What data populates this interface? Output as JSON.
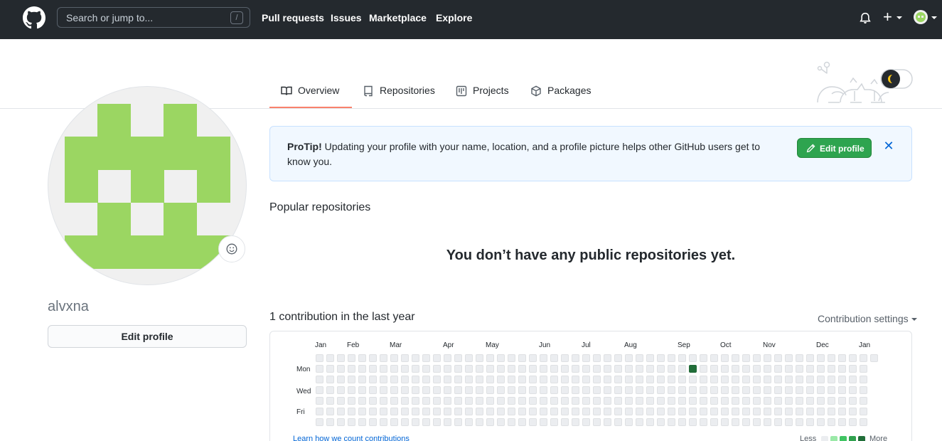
{
  "header": {
    "search_placeholder": "Search or jump to...",
    "search_shortcut": "/",
    "nav": [
      "Pull requests",
      "Issues",
      "Marketplace",
      "Explore"
    ],
    "plus": "+"
  },
  "tabs": [
    {
      "label": "Overview",
      "icon": "book-icon",
      "selected": true
    },
    {
      "label": "Repositories",
      "icon": "repo-icon"
    },
    {
      "label": "Projects",
      "icon": "project-icon"
    },
    {
      "label": "Packages",
      "icon": "package-icon"
    }
  ],
  "profile": {
    "username": "alvxna",
    "edit_label": "Edit profile",
    "avatar_color": "#9bd662"
  },
  "protip": {
    "title": "ProTip!",
    "text": "Updating your profile with your name, location, and a profile picture helps other GitHub users get to know you.",
    "button": "Edit profile",
    "close": "✕"
  },
  "repos": {
    "title": "Popular repositories",
    "empty": "You don’t have any public repositories yet."
  },
  "contributions": {
    "title": "1 contribution in the last year",
    "settings": "Contribution settings",
    "months": [
      "Jan",
      "Feb",
      "Mar",
      "Apr",
      "May",
      "Jun",
      "Jul",
      "Aug",
      "Sep",
      "Oct",
      "Nov",
      "Dec",
      "Jan"
    ],
    "days": [
      "Mon",
      "Wed",
      "Fri"
    ],
    "learn": "Learn how we count contributions",
    "less": "Less",
    "more": "More",
    "active_week": 35,
    "active_day": 1,
    "colors": [
      "#ebedf0",
      "#9be9a8",
      "#40c463",
      "#30a14e",
      "#216e39"
    ]
  }
}
